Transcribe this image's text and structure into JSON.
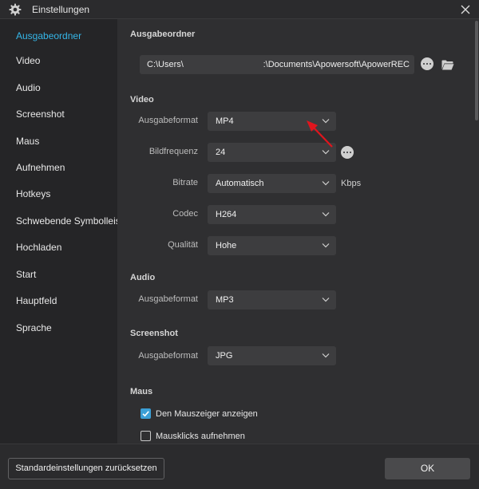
{
  "window": {
    "title": "Einstellungen",
    "icon": "gear-icon"
  },
  "sidebar": {
    "items": [
      {
        "label": "Ausgabeordner",
        "active": true
      },
      {
        "label": "Video"
      },
      {
        "label": "Audio"
      },
      {
        "label": "Screenshot"
      },
      {
        "label": "Maus"
      },
      {
        "label": "Aufnehmen"
      },
      {
        "label": "Hotkeys"
      },
      {
        "label": "Schwebende Symbolleiste"
      },
      {
        "label": "Hochladen"
      },
      {
        "label": "Start"
      },
      {
        "label": "Hauptfeld"
      },
      {
        "label": "Sprache"
      }
    ]
  },
  "output_folder": {
    "title": "Ausgabeordner",
    "path_start": "C:\\Users\\",
    "path_end": ":\\Documents\\Apowersoft\\ApowerREC"
  },
  "video": {
    "title": "Video",
    "format": {
      "label": "Ausgabeformat",
      "value": "MP4"
    },
    "framerate": {
      "label": "Bildfrequenz",
      "value": "24"
    },
    "bitrate": {
      "label": "Bitrate",
      "value": "Automatisch",
      "unit": "Kbps"
    },
    "codec": {
      "label": "Codec",
      "value": "H264"
    },
    "quality": {
      "label": "Qualität",
      "value": "Hohe"
    }
  },
  "audio": {
    "title": "Audio",
    "format": {
      "label": "Ausgabeformat",
      "value": "MP3"
    }
  },
  "screenshot": {
    "title": "Screenshot",
    "format": {
      "label": "Ausgabeformat",
      "value": "JPG"
    }
  },
  "mouse": {
    "title": "Maus",
    "show_cursor": {
      "label": "Den Mauszeiger anzeigen",
      "checked": true
    },
    "record_clicks": {
      "label": "Mausklicks aufnehmen",
      "checked": false
    }
  },
  "footer": {
    "reset_label": "Standardeinstellungen zurücksetzen",
    "ok_label": "OK"
  },
  "colors": {
    "accent": "#35b6e8",
    "annotation_arrow": "#e0151d",
    "checkbox": "#3b9fd6"
  }
}
